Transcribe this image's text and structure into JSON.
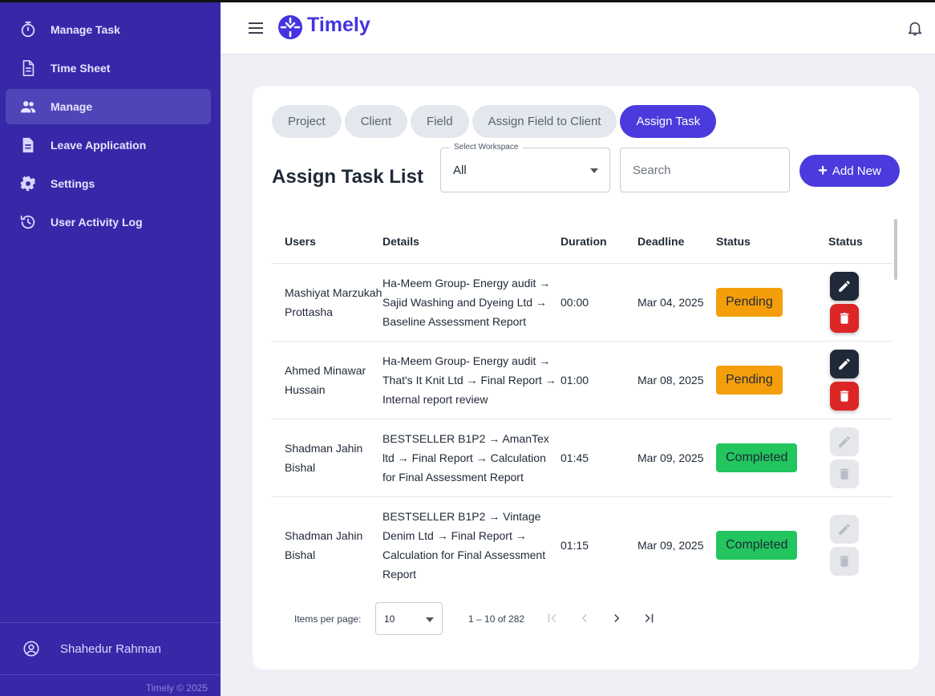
{
  "sidebar": {
    "items": [
      {
        "label": "Manage Task",
        "icon": "timer-icon"
      },
      {
        "label": "Time Sheet",
        "icon": "document-icon"
      },
      {
        "label": "Manage",
        "icon": "people-icon"
      },
      {
        "label": "Leave Application",
        "icon": "file-icon"
      },
      {
        "label": "Settings",
        "icon": "gear-icon"
      },
      {
        "label": "User Activity Log",
        "icon": "history-icon"
      }
    ],
    "active_item": "Manage",
    "user_name": "Shahedur Rahman",
    "copyright": "Timely © 2025"
  },
  "header": {
    "app_name": "Timely"
  },
  "tabs": [
    "Project",
    "Client",
    "Field",
    "Assign Field to Client",
    "Assign Task"
  ],
  "active_tab": "Assign Task",
  "page": {
    "title": "Assign Task List",
    "workspace_label": "Select Workspace",
    "workspace_value": "All",
    "search_placeholder": "Search",
    "add_label": "Add New"
  },
  "table": {
    "columns": [
      "Users",
      "Details",
      "Duration",
      "Deadline",
      "Status",
      "Status"
    ],
    "rows": [
      {
        "user": "Mashiyat Marzukah Prottasha",
        "details": "Ha-Meem Group- Energy audit → Sajid Washing and Dyeing Ltd → Baseline Assessment Report",
        "duration": "00:00",
        "deadline": "Mar 04, 2025",
        "status": "Pending"
      },
      {
        "user": "Ahmed Minawar Hussain",
        "details": "Ha-Meem Group- Energy audit → That's It Knit Ltd → Final Report → Internal report review",
        "duration": "01:00",
        "deadline": "Mar 08, 2025",
        "status": "Pending"
      },
      {
        "user": "Shadman Jahin Bishal",
        "details": "BESTSELLER B1P2 → AmanTex ltd → Final Report → Calculation for Final Assessment Report",
        "duration": "01:45",
        "deadline": "Mar 09, 2025",
        "status": "Completed"
      },
      {
        "user": "Shadman Jahin Bishal",
        "details": "BESTSELLER B1P2 → Vintage Denim Ltd → Final Report → Calculation for Final Assessment Report",
        "duration": "01:15",
        "deadline": "Mar 09, 2025",
        "status": "Completed"
      }
    ]
  },
  "paginator": {
    "items_per_page_label": "Items per page:",
    "items_per_page": "10",
    "range_label": "1 – 10 of 282"
  },
  "colors": {
    "sidebar_bg": "#3728a8",
    "accent": "#4b3bdc",
    "pending": "#f59e0b",
    "completed": "#22c55e",
    "delete": "#dc2626"
  }
}
